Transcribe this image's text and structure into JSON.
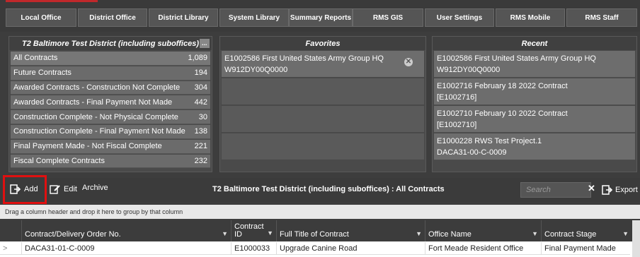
{
  "nav": {
    "buttons": [
      "Local Office",
      "District Office",
      "District Library",
      "System Library",
      "Summary Reports",
      "RMS GIS",
      "User Settings",
      "RMS Mobile",
      "RMS Staff"
    ]
  },
  "contracts_panel": {
    "title": "T2 Baltimore Test District (including suboffices)",
    "more_label": "...",
    "items": [
      {
        "label": "All Contracts",
        "count": "1,089"
      },
      {
        "label": "Future Contracts",
        "count": "194"
      },
      {
        "label": "Awarded Contracts - Construction Not Complete",
        "count": "304"
      },
      {
        "label": "Awarded Contracts - Final Payment Not Made",
        "count": "442"
      },
      {
        "label": "Construction Complete - Not Physical Complete",
        "count": "30"
      },
      {
        "label": "Construction Complete - Final Payment Not Made",
        "count": "138"
      },
      {
        "label": "Final Payment Made - Not Fiscal Complete",
        "count": "221"
      },
      {
        "label": "Fiscal Complete Contracts",
        "count": "232"
      }
    ]
  },
  "favorites_panel": {
    "title": "Favorites",
    "items": [
      {
        "line1": "E1002586   First United States Army Group  HQ",
        "line2": "W912DY00Q0000"
      }
    ],
    "remove_icon": "close-circle-icon"
  },
  "recent_panel": {
    "title": "Recent",
    "items": [
      {
        "line1": "E1002586   First United States Army Group  HQ",
        "line2": "W912DY00Q0000"
      },
      {
        "line1": "E1002716   February 18 2022 Contract",
        "line2": "[E1002716]"
      },
      {
        "line1": "E1002710   February 10 2022 Contract",
        "line2": "[E1002710]"
      },
      {
        "line1": "E1000228   RWS Test Project.1",
        "line2": "DACA31-00-C-0009"
      }
    ]
  },
  "toolbar": {
    "add_label": "Add",
    "edit_label": "Edit",
    "archive_label": "Archive",
    "title": "T2 Baltimore Test District (including suboffices)  :  All Contracts",
    "search_placeholder": "Search",
    "clear_label": "✕",
    "export_label": "Export"
  },
  "group_hint": "Drag a column header and drop it here to group by that column",
  "grid": {
    "columns": [
      "Contract/Delivery Order No.",
      "Contract ID",
      "Full Title of Contract",
      "Office Name",
      "Contract Stage"
    ],
    "rows": [
      {
        "order_no": "DACA31-01-C-0009",
        "contract_id": "E1000033",
        "title": "Upgrade Canine Road",
        "office": "Fort Meade Resident Office",
        "stage": "Final Payment Made"
      }
    ]
  },
  "colors": {
    "accent_red": "#e01010",
    "panel_bg": "#4a4a4a",
    "row_bg": "#6b6b6b"
  }
}
